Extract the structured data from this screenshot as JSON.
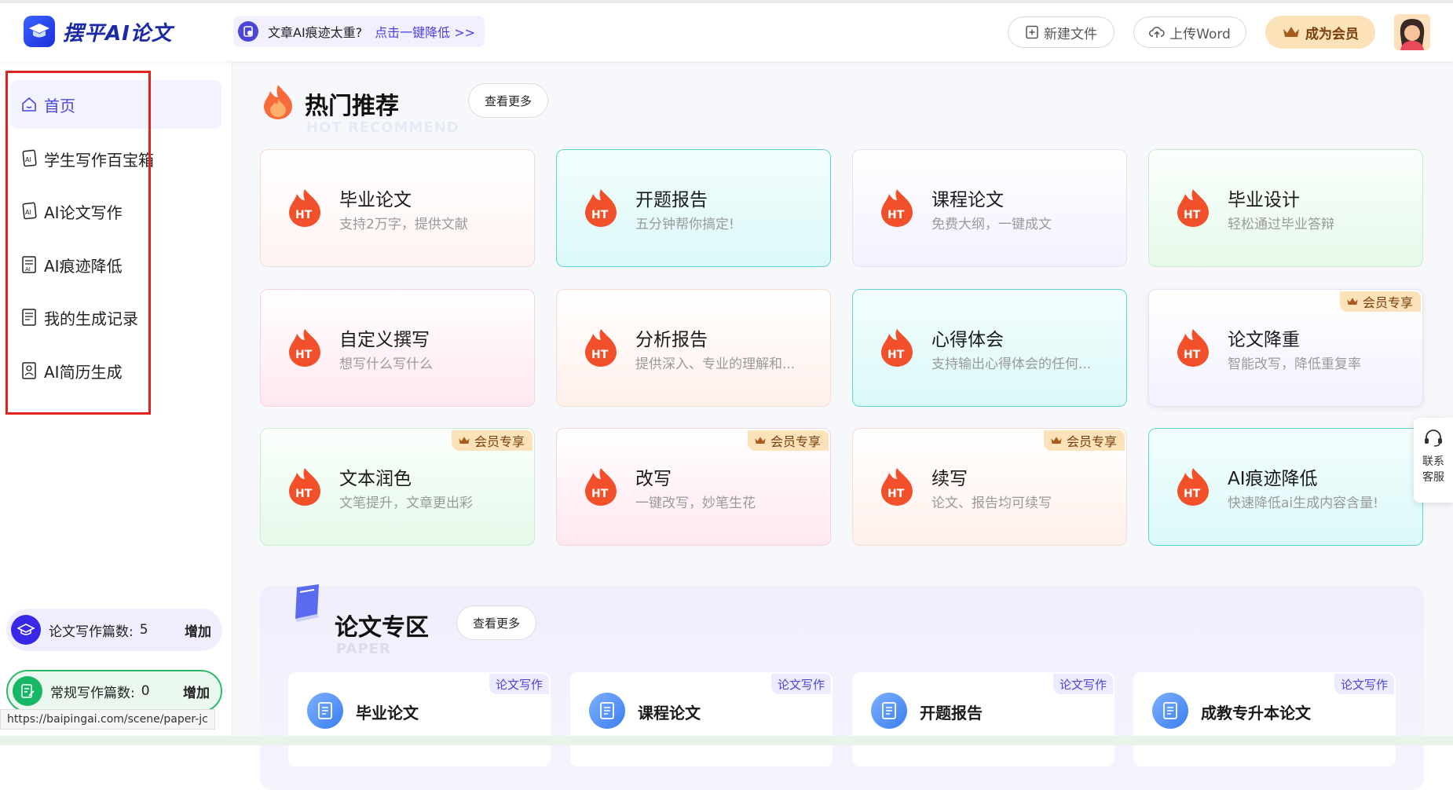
{
  "header": {
    "logo_text": "摆平AI论文",
    "promo_text": "文章AI痕迹太重?",
    "promo_link": "点击一键降低 >>",
    "new_file": "新建文件",
    "upload_word": "上传Word",
    "become_vip": "成为会员"
  },
  "sidebar": {
    "items": [
      {
        "label": "首页",
        "icon": "home-icon"
      },
      {
        "label": "学生写作百宝箱",
        "icon": "ai-doc-icon"
      },
      {
        "label": "AI论文写作",
        "icon": "ai-doc-icon"
      },
      {
        "label": "AI痕迹降低",
        "icon": "ai-report-icon"
      },
      {
        "label": "我的生成记录",
        "icon": "record-icon"
      },
      {
        "label": "AI简历生成",
        "icon": "resume-icon"
      }
    ],
    "quota_paper": {
      "label": "论文写作篇数:",
      "count": "5",
      "add": "增加"
    },
    "quota_normal": {
      "label": "常规写作篇数:",
      "count": "0",
      "add": "增加"
    }
  },
  "status_url": "https://baipingai.com/scene/paper-jc",
  "hot": {
    "title": "热门推荐",
    "subtitle": "HOT RECOMMEND",
    "more": "查看更多",
    "badge_text": "会员专享",
    "icon_text": "HT",
    "cards": [
      {
        "title": "毕业论文",
        "desc": "支持2万字，提供文献"
      },
      {
        "title": "开题报告",
        "desc": "五分钟帮你搞定!"
      },
      {
        "title": "课程论文",
        "desc": "免费大纲，一键成文"
      },
      {
        "title": "毕业设计",
        "desc": "轻松通过毕业答辩"
      },
      {
        "title": "自定义撰写",
        "desc": "想写什么写什么"
      },
      {
        "title": "分析报告",
        "desc": "提供深入、专业的理解和..."
      },
      {
        "title": "心得体会",
        "desc": "支持输出心得体会的任何..."
      },
      {
        "title": "论文降重",
        "desc": "智能改写，降低重复率"
      },
      {
        "title": "文本润色",
        "desc": "文笔提升，文章更出彩"
      },
      {
        "title": "改写",
        "desc": "一键改写，妙笔生花"
      },
      {
        "title": "续写",
        "desc": "论文、报告均可续写"
      },
      {
        "title": "AI痕迹降低",
        "desc": "快速降低ai生成内容含量!"
      }
    ]
  },
  "paper": {
    "title": "论文专区",
    "subtitle": "PAPER",
    "more": "查看更多",
    "tag": "论文写作",
    "cards": [
      {
        "title": "毕业论文"
      },
      {
        "title": "课程论文"
      },
      {
        "title": "开题报告"
      },
      {
        "title": "成教专升本论文"
      }
    ]
  },
  "service": {
    "line1": "联系",
    "line2": "客服"
  },
  "colors": {
    "brand": "#4b46d8",
    "vip": "#fbe2b9",
    "frame_red": "#e0231f",
    "flame": "#f2502a"
  }
}
